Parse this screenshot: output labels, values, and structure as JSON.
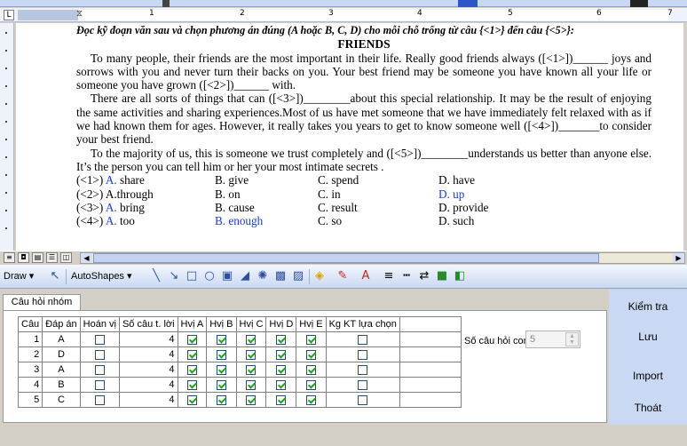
{
  "ruler": {
    "numbers": [
      "1",
      "2",
      "3",
      "4",
      "5",
      "6",
      "7"
    ]
  },
  "document": {
    "instruction": "Đọc kỹ đoạn văn sau và chọn phương án đúng  (A hoặc B, C, D) cho mỗi chỗ trống từ câu {<1>} đến câu {<5>}:",
    "title": "FRIENDS",
    "p1": "To many people, their friends are the most important in their life. Really good friends always ([<1>])______ joys and sorrows with you and never turn their backs on you. Your best friend may be someone you have known all your life or someone you  have grown ([<2>])______ with.",
    "p2": "There are all sorts of things that can ([<3>])________about this special relationship. It may be the result of enjoying the same activities and sharing experiences.Most of us have met someone that we have immediately felt  relaxed with as if we had known them for ages. However, it really takes you years to get to know someone well ([<4>])_______to consider your best friend.",
    "p3": "To the majority of us, this is someone we trust completely and ([<5>])________understands us better than anyone else. It’s the person you can tell him or her your most intimate secrets .",
    "options": [
      {
        "q": "(<1>)",
        "a": "A.",
        "a_text": " share",
        "b": "B. give",
        "c": "C. spend",
        "d": "D. have"
      },
      {
        "q": "(<2>)",
        "a": "A.",
        "a_text": "through",
        "b": "B. on",
        "c": "C. in",
        "d": "D. up"
      },
      {
        "q": "(<3>)",
        "a": "A.",
        "a_text": " bring",
        "b": "B. cause",
        "c": "C. result",
        "d": "D. provide"
      },
      {
        "q": "(<4>)",
        "a": "A.",
        "a_text": " too",
        "b": "B. enough",
        "c": "C. so",
        "d": "D. such"
      }
    ]
  },
  "drawbar": {
    "draw": "Draw",
    "autoshapes": "AutoShapes"
  },
  "panel": {
    "tab": "Câu hỏi nhóm",
    "headers": [
      "Câu",
      "Đáp án",
      "Hoán vị",
      "Số câu t. lời",
      "Hvị A",
      "Hvị B",
      "Hvị C",
      "Hvị D",
      "Hvị E",
      "Kg KT lựa chọn"
    ],
    "rows": [
      {
        "num": "1",
        "ans": "A",
        "count": "4"
      },
      {
        "num": "2",
        "ans": "D",
        "count": "4"
      },
      {
        "num": "3",
        "ans": "A",
        "count": "4"
      },
      {
        "num": "4",
        "ans": "B",
        "count": "4"
      },
      {
        "num": "5",
        "ans": "C",
        "count": "4"
      }
    ],
    "sub_label": "Số câu hỏi con",
    "sub_value": "5",
    "buttons": {
      "check": "Kiểm tra",
      "save": "Lưu",
      "import": "Import",
      "exit": "Thoát"
    }
  }
}
